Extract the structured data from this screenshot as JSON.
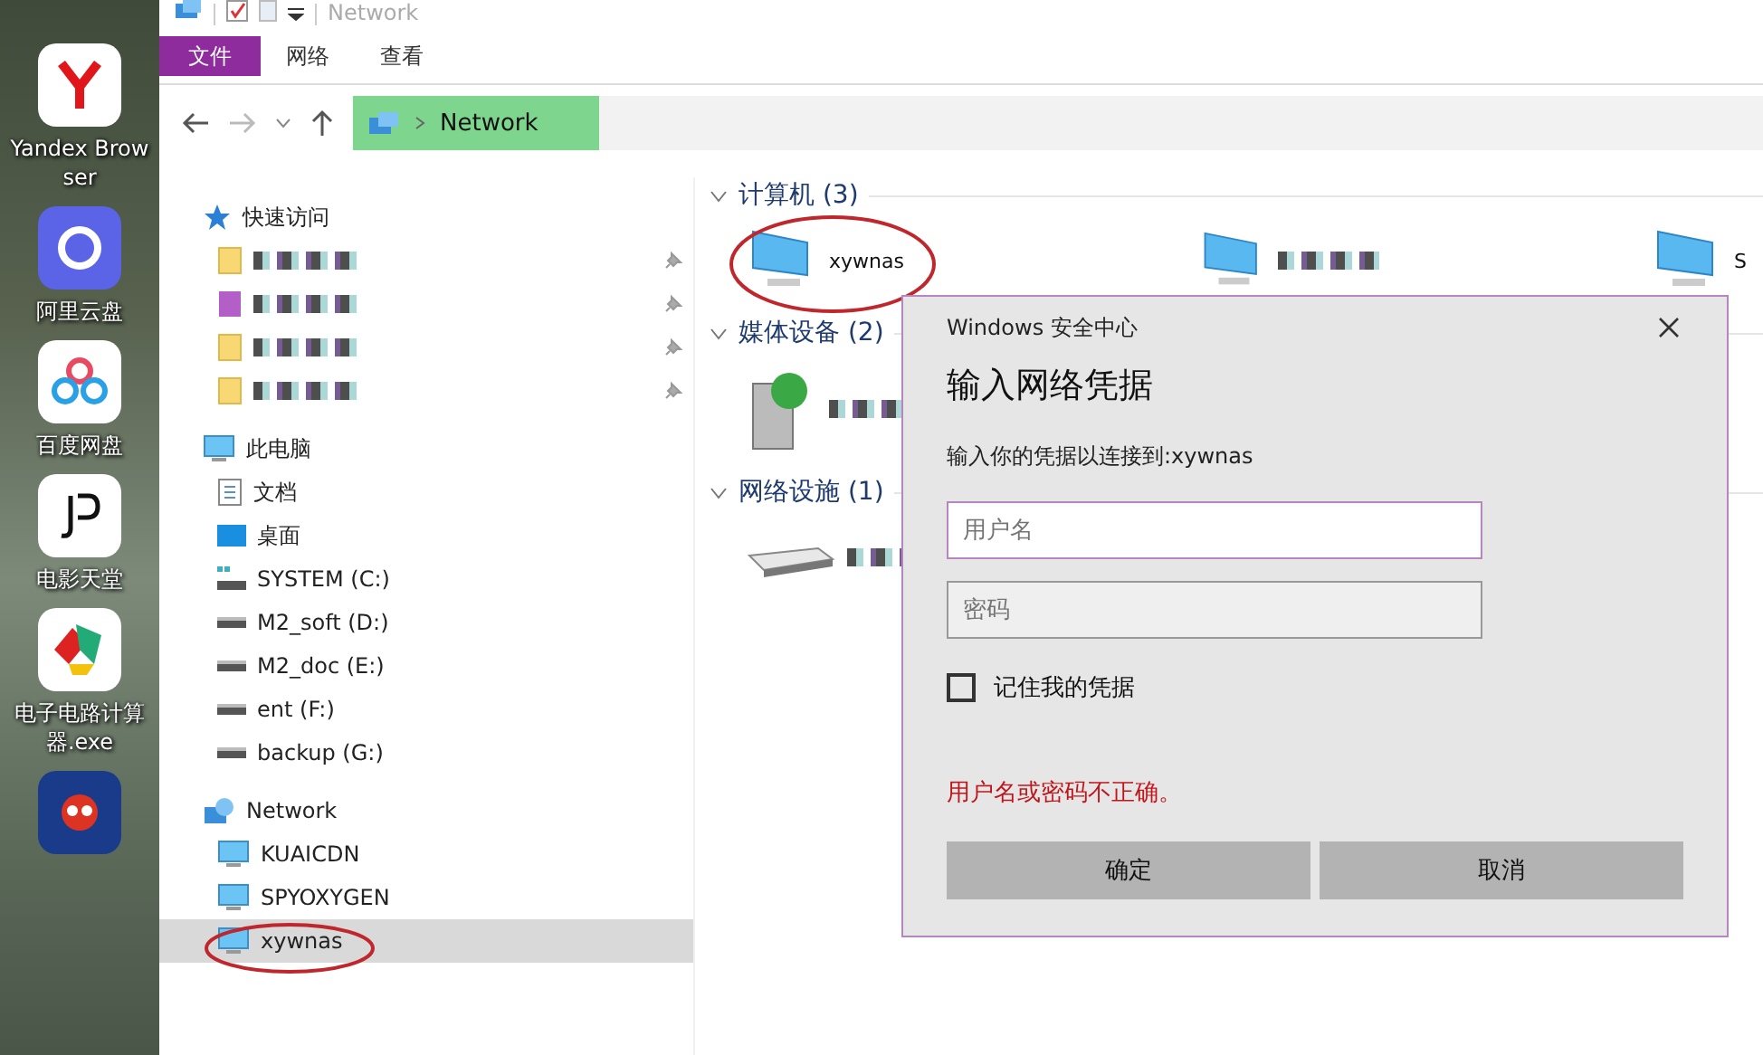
{
  "desktop": {
    "icons": [
      {
        "label": "Yandex Browser",
        "kind": "yandex"
      },
      {
        "label": "阿里云盘",
        "kind": "aliyun"
      },
      {
        "label": "百度网盘",
        "kind": "baidu"
      },
      {
        "label": "电影天堂",
        "kind": "movie"
      },
      {
        "label": "电子电路计算器.exe",
        "kind": "chinafix"
      },
      {
        "kind": "game"
      }
    ]
  },
  "explorer": {
    "title": "Network",
    "ribbon_tabs": [
      {
        "label": "文件",
        "selected": true
      },
      {
        "label": "网络",
        "selected": false
      },
      {
        "label": "查看",
        "selected": false
      }
    ],
    "address": {
      "path": "Network"
    },
    "sidebar": {
      "sections": [
        {
          "label": "快速访问",
          "kind": "star",
          "selected": false,
          "children": [
            {
              "kind": "folder",
              "pinned": true,
              "selected": false
            },
            {
              "kind": "app",
              "pinned": true,
              "selected": false
            },
            {
              "kind": "folder",
              "pinned": true,
              "selected": false
            },
            {
              "kind": "folder",
              "pinned": true,
              "selected": false
            }
          ]
        },
        {
          "label": "此电脑",
          "kind": "pc",
          "selected": false,
          "children": [
            {
              "label": "文档",
              "kind": "doc",
              "selected": false
            },
            {
              "label": "桌面",
              "kind": "desktop",
              "selected": false
            },
            {
              "label": "SYSTEM (C:)",
              "kind": "sysdrive",
              "selected": false
            },
            {
              "label": "M2_soft (D:)",
              "kind": "drive",
              "selected": false
            },
            {
              "label": "M2_doc (E:)",
              "kind": "drive",
              "selected": false
            },
            {
              "label": "ent (F:)",
              "kind": "drive",
              "selected": false
            },
            {
              "label": "backup (G:)",
              "kind": "drive",
              "selected": false
            }
          ]
        },
        {
          "label": "Network",
          "kind": "network",
          "selected": false,
          "children": [
            {
              "label": "KUAICDN",
              "kind": "pc",
              "selected": false
            },
            {
              "label": "SPYOXYGEN",
              "kind": "pc",
              "selected": false
            },
            {
              "label": "xywnas",
              "kind": "pc",
              "selected": true
            }
          ]
        }
      ]
    },
    "groups": [
      {
        "label": "计算机 (3)",
        "items": [
          {
            "label": "xywnas",
            "kind": "pc"
          },
          {
            "kind": "pc"
          },
          {
            "label": "S",
            "kind": "pc"
          }
        ]
      },
      {
        "label": "媒体设备 (2)",
        "items": [
          {
            "kind": "media"
          }
        ]
      },
      {
        "label": "网络设施 (1)",
        "items": [
          {
            "kind": "router"
          }
        ]
      }
    ]
  },
  "dialog": {
    "caption": "Windows 安全中心",
    "title": "输入网络凭据",
    "message": "输入你的凭据以连接到:xywnas",
    "username": {
      "placeholder": "用户名"
    },
    "password": {
      "placeholder": "密码"
    },
    "remember": {
      "label": "记住我的凭据",
      "checked": false
    },
    "error": "用户名或密码不正确。",
    "buttons": [
      "确定",
      "取消"
    ]
  }
}
